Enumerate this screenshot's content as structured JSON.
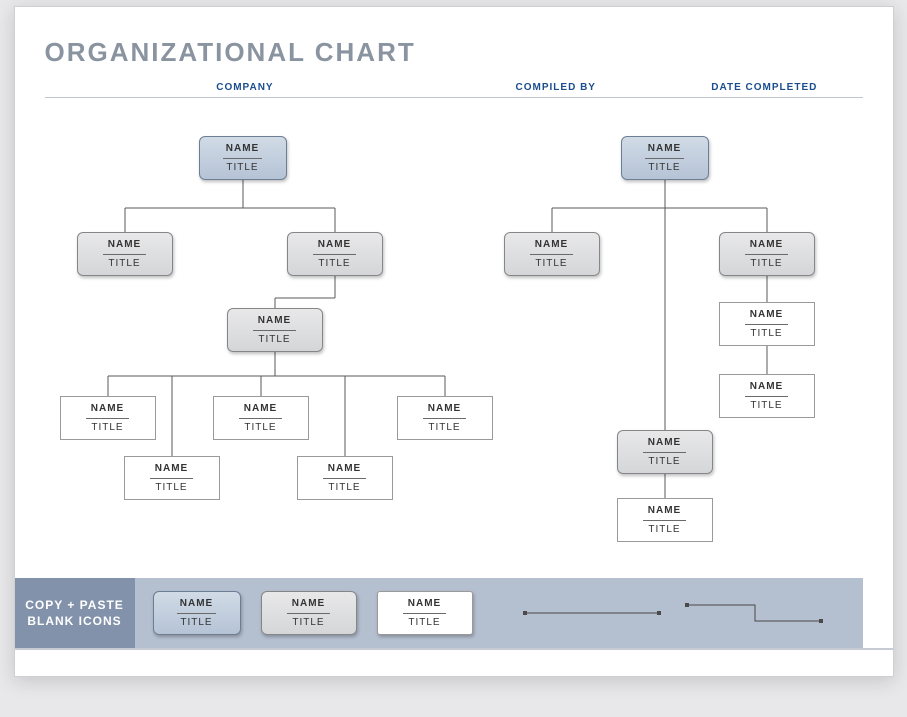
{
  "title": "ORGANIZATIONAL CHART",
  "meta": {
    "company_label": "COMPANY",
    "compiled_by_label": "COMPILED BY",
    "date_completed_label": "DATE COMPLETED"
  },
  "fields": {
    "name": "NAME",
    "title": "TITLE"
  },
  "footer": {
    "copy_paste": "COPY + PASTE\nBLANK ICONS"
  }
}
